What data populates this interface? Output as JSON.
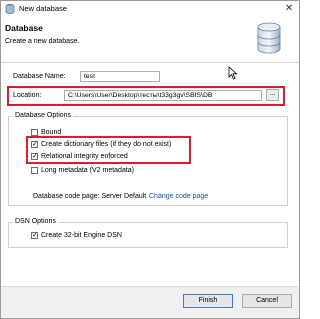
{
  "window": {
    "title": "New database"
  },
  "header": {
    "title": "Database",
    "subtitle": "Create a new database."
  },
  "form": {
    "name_label": "Database Name:",
    "name_value": "test",
    "location_label": "Location:",
    "location_value": "C:\\Users\\User\\Desktop\\тесты\\t33g3gv\\SBIS\\DB",
    "browse_label": "..."
  },
  "options": {
    "title": "Database Options",
    "items": [
      {
        "label": "Bound",
        "checked": false
      },
      {
        "label": "Create dictionary files (if they do not exist)",
        "checked": true
      },
      {
        "label": "Relational integrity enforced",
        "checked": true
      },
      {
        "label": "Long metadata (V2 metadata)",
        "checked": false
      }
    ],
    "code_page_label": "Database code page: Server Default",
    "change_code_page": "Change code page"
  },
  "dsn": {
    "title": "DSN Options",
    "item": {
      "label": "Create 32-bit Engine DSN",
      "checked": true
    }
  },
  "buttons": {
    "finish": "Finish",
    "cancel": "Cancel"
  },
  "colors": {
    "highlight": "#e01b2b",
    "link": "#1a4fb4",
    "accent": "#3b7bd6"
  },
  "icons": {
    "app": "database-app-icon",
    "header": "database-cylinder-icon",
    "close": "close-icon",
    "cursor": "mouse-cursor-icon"
  }
}
